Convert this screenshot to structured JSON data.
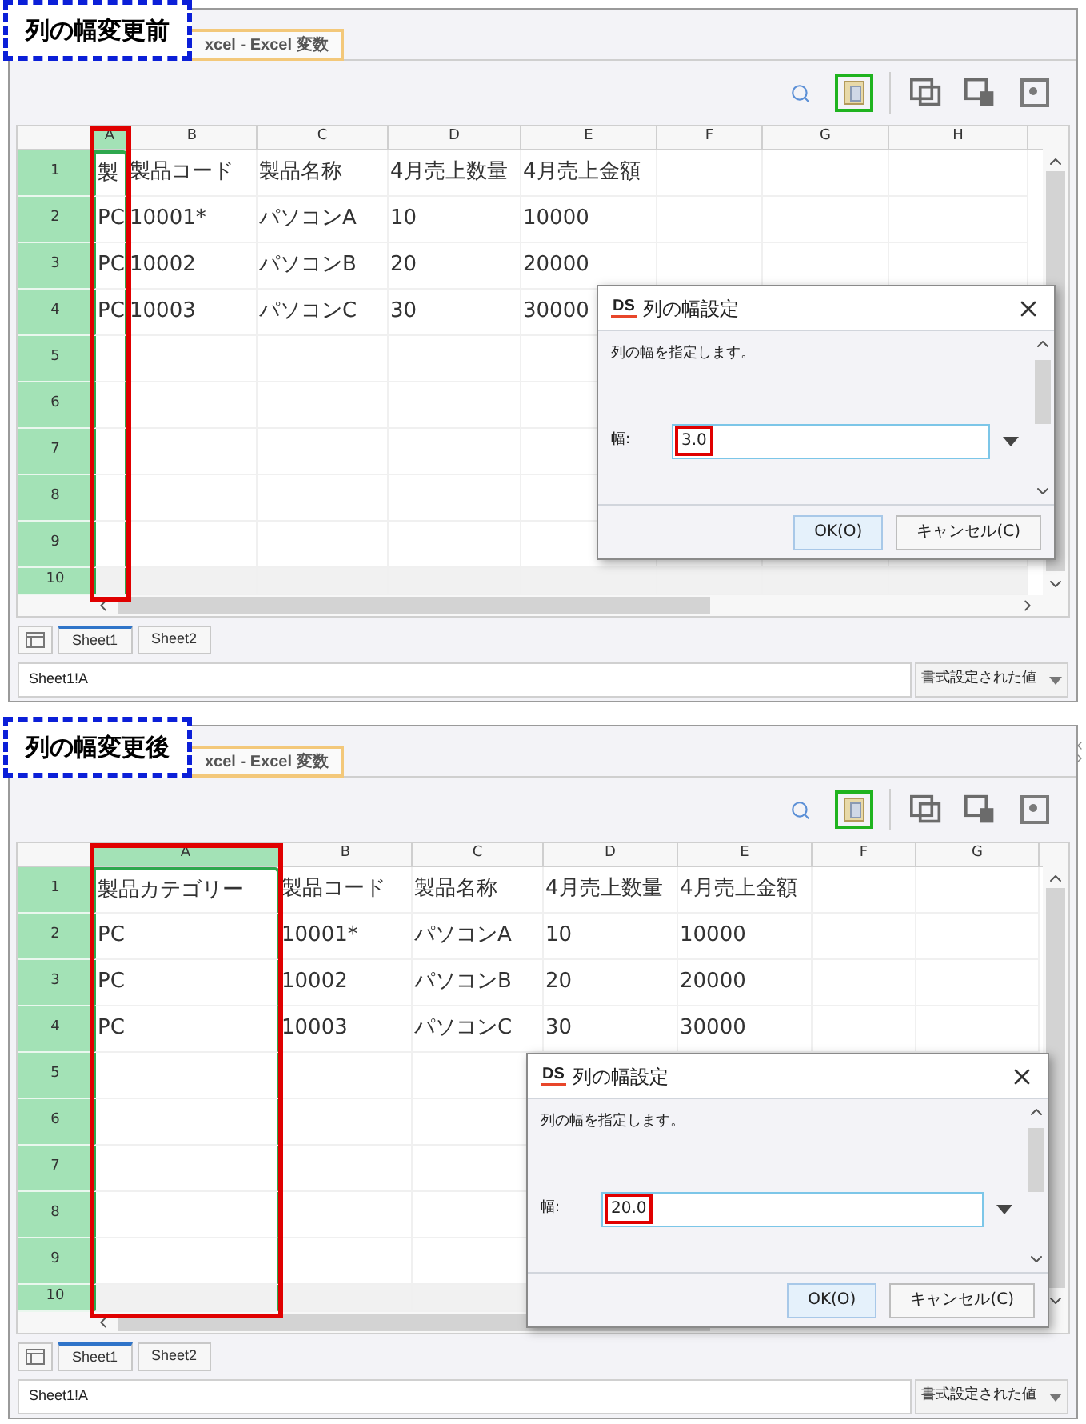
{
  "panels": [
    {
      "caption": "列の幅変更前",
      "tab": "xcel - Excel 変数",
      "side_handle": false,
      "toolbar": [
        {
          "highlighted": false
        },
        {
          "highlighted": true
        },
        {
          "highlighted": false
        },
        {
          "highlighted": false
        },
        {
          "highlighted": false
        }
      ],
      "columns": [
        {
          "label": "A",
          "selected": true,
          "highlighted": true
        },
        {
          "label": "B",
          "selected": false,
          "highlighted": false
        },
        {
          "label": "C",
          "selected": false,
          "highlighted": false
        },
        {
          "label": "D",
          "selected": false,
          "highlighted": false
        },
        {
          "label": "E",
          "selected": false,
          "highlighted": false
        },
        {
          "label": "F",
          "selected": false,
          "highlighted": false
        },
        {
          "label": "G",
          "selected": false,
          "highlighted": false
        },
        {
          "label": "H",
          "selected": false,
          "highlighted": false
        }
      ],
      "rows": [
        {
          "header": "1",
          "cells": [
            "製",
            "製品コード",
            "製品名称",
            "4月売上数量",
            "4月売上金額"
          ]
        },
        {
          "header": "2",
          "cells": [
            "PC",
            "10001*",
            "パソコンA",
            "10",
            "10000"
          ]
        },
        {
          "header": "3",
          "cells": [
            "PC",
            "10002",
            "パソコンB",
            "20",
            "20000"
          ]
        },
        {
          "header": "4",
          "cells": [
            "PC",
            "10003",
            "パソコンC",
            "30",
            "30000"
          ]
        },
        {
          "header": "5",
          "cells": []
        },
        {
          "header": "6",
          "cells": []
        },
        {
          "header": "7",
          "cells": []
        },
        {
          "header": "8",
          "cells": []
        },
        {
          "header": "9",
          "cells": []
        },
        {
          "header": "10",
          "cells": []
        }
      ],
      "sheet_tabs": [
        {
          "label": "Sheet1",
          "selected": true
        },
        {
          "label": "Sheet2",
          "selected": false
        }
      ],
      "cell_reference": "Sheet1!A",
      "value_mode": "書式設定された値",
      "dialog": {
        "logo": "DS",
        "title": "列の幅設定",
        "message": "列の幅を指定します。",
        "field_label": "幅:",
        "value": "3.0",
        "value_highlighted": true,
        "buttons": [
          {
            "label": "OK(O)",
            "default": true
          },
          {
            "label": "キャンセル(C)",
            "default": false
          }
        ]
      }
    },
    {
      "caption": "列の幅変更後",
      "tab": "xcel - Excel 変数",
      "side_handle": true,
      "toolbar": [
        {
          "highlighted": false
        },
        {
          "highlighted": true
        },
        {
          "highlighted": false
        },
        {
          "highlighted": false
        },
        {
          "highlighted": false
        }
      ],
      "columns": [
        {
          "label": "A",
          "selected": true,
          "highlighted": true
        },
        {
          "label": "B",
          "selected": false,
          "highlighted": false
        },
        {
          "label": "C",
          "selected": false,
          "highlighted": false
        },
        {
          "label": "D",
          "selected": false,
          "highlighted": false
        },
        {
          "label": "E",
          "selected": false,
          "highlighted": false
        },
        {
          "label": "F",
          "selected": false,
          "highlighted": false
        },
        {
          "label": "G",
          "selected": false,
          "highlighted": false
        }
      ],
      "rows": [
        {
          "header": "1",
          "cells": [
            "製品カテゴリー",
            "製品コード",
            "製品名称",
            "4月売上数量",
            "4月売上金額"
          ]
        },
        {
          "header": "2",
          "cells": [
            "PC",
            "10001*",
            "パソコンA",
            "10",
            "10000"
          ]
        },
        {
          "header": "3",
          "cells": [
            "PC",
            "10002",
            "パソコンB",
            "20",
            "20000"
          ]
        },
        {
          "header": "4",
          "cells": [
            "PC",
            "10003",
            "パソコンC",
            "30",
            "30000"
          ]
        },
        {
          "header": "5",
          "cells": []
        },
        {
          "header": "6",
          "cells": []
        },
        {
          "header": "7",
          "cells": []
        },
        {
          "header": "8",
          "cells": []
        },
        {
          "header": "9",
          "cells": []
        },
        {
          "header": "10",
          "cells": []
        }
      ],
      "sheet_tabs": [
        {
          "label": "Sheet1",
          "selected": true
        },
        {
          "label": "Sheet2",
          "selected": false
        }
      ],
      "cell_reference": "Sheet1!A",
      "value_mode": "書式設定された値",
      "dialog": {
        "logo": "DS",
        "title": "列の幅設定",
        "message": "列の幅を指定します。",
        "field_label": "幅:",
        "value": "20.0",
        "value_highlighted": true,
        "buttons": [
          {
            "label": "OK(O)",
            "default": true
          },
          {
            "label": "キャンセル(C)",
            "default": false
          }
        ]
      }
    }
  ]
}
